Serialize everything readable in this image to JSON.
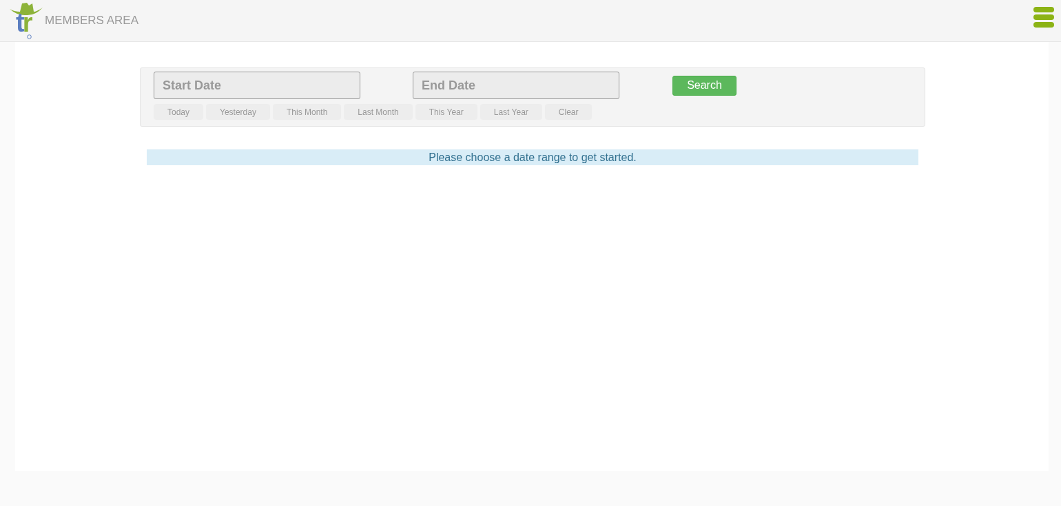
{
  "header": {
    "logo_letters": [
      {
        "text": "t",
        "color": "#5b7ec0"
      },
      {
        "text": "r",
        "color": "#8db33a"
      }
    ],
    "title": "MEMBERS AREA"
  },
  "filter": {
    "start_date": {
      "placeholder": "Start Date"
    },
    "end_date": {
      "placeholder": "End Date"
    },
    "search_button": "Search",
    "quick_ranges": [
      "Today",
      "Yesterday",
      "This Month",
      "Last Month",
      "This Year",
      "Last Year",
      "Clear"
    ]
  },
  "message": "Please choose a date range to get started."
}
